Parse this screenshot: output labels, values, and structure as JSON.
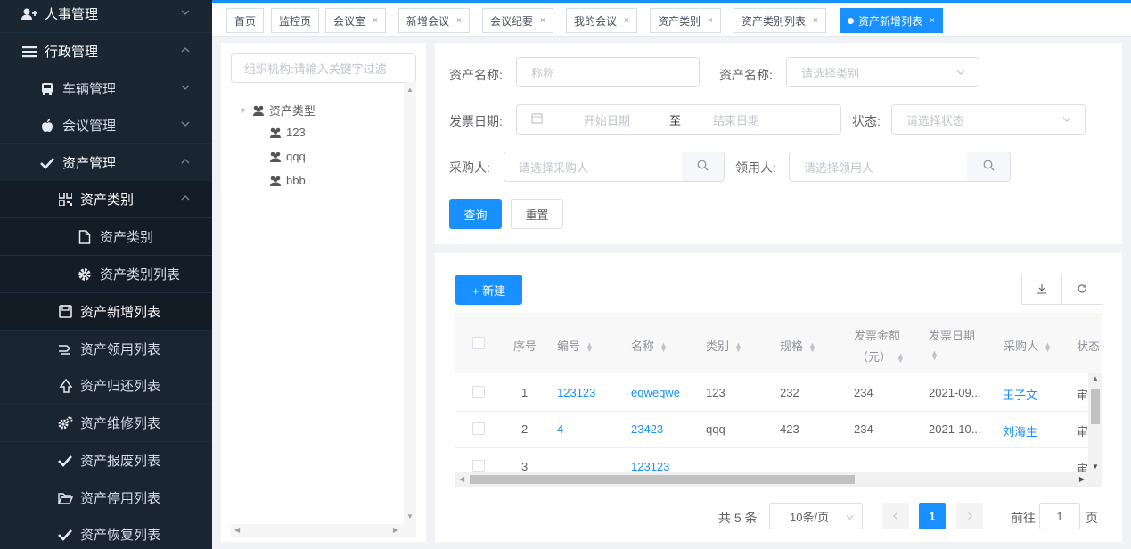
{
  "sidebar": {
    "items": [
      {
        "label": "人事管理",
        "icon": "user-add-icon",
        "chevron": "down"
      },
      {
        "label": "行政管理",
        "icon": "menu-icon",
        "chevron": "up"
      },
      {
        "label": "车辆管理",
        "icon": "bus-icon",
        "chevron": "down"
      },
      {
        "label": "会议管理",
        "icon": "apple-icon",
        "chevron": "down"
      },
      {
        "label": "资产管理",
        "icon": "check-icon",
        "chevron": "up"
      },
      {
        "label": "资产类别",
        "icon": "qrcode-icon",
        "chevron": "up"
      },
      {
        "label": "资产类别",
        "icon": "document-icon"
      },
      {
        "label": "资产类别列表",
        "icon": "gear-icon"
      },
      {
        "label": "资产新增列表",
        "icon": "save-icon"
      },
      {
        "label": "资产领用列表",
        "icon": "receive-icon"
      },
      {
        "label": "资产归还列表",
        "icon": "return-icon"
      },
      {
        "label": "资产维修列表",
        "icon": "gears-icon"
      },
      {
        "label": "资产报废列表",
        "icon": "check-icon"
      },
      {
        "label": "资产停用列表",
        "icon": "folder-open-icon"
      },
      {
        "label": "资产恢复列表",
        "icon": "check-icon"
      }
    ]
  },
  "tabs": [
    {
      "label": "首页",
      "closable": false
    },
    {
      "label": "监控页",
      "closable": false
    },
    {
      "label": "会议室",
      "closable": true
    },
    {
      "label": "新增会议",
      "closable": true
    },
    {
      "label": "会议纪要",
      "closable": true
    },
    {
      "label": "我的会议",
      "closable": true
    },
    {
      "label": "资产类别",
      "closable": true
    },
    {
      "label": "资产类别列表",
      "closable": true
    },
    {
      "label": "资产新增列表",
      "closable": true,
      "active": true
    }
  ],
  "tab_close_glyph": "×",
  "tree": {
    "search_placeholder": "组织机构:请输入关键字过滤",
    "root": "资产类型",
    "children": [
      "123",
      "qqq",
      "bbb"
    ]
  },
  "search": {
    "asset_name_label": "资产名称:",
    "asset_name_placeholder": "称称",
    "category_label": "资产名称:",
    "category_placeholder": "请选择类别",
    "invoice_date_label": "发票日期:",
    "start_placeholder": "开始日期",
    "range_sep": "至",
    "end_placeholder": "结束日期",
    "status_label": "状态:",
    "status_placeholder": "请选择状态",
    "buyer_label": "采购人:",
    "buyer_placeholder": "请选择采购人",
    "receiver_label": "领用人:",
    "receiver_placeholder": "请选择领用人",
    "query_button": "查询",
    "reset_button": "重置"
  },
  "table": {
    "new_button": "+ 新建",
    "columns": [
      "序号",
      "编号",
      "名称",
      "类别",
      "规格",
      "发票金额",
      "（元）",
      "发票日期",
      "采购人",
      "状态"
    ],
    "rows": [
      {
        "index": "1",
        "code": "123123",
        "name": "eqweqwe",
        "category": "123",
        "spec": "232",
        "amount": "234",
        "date": "2021-09...",
        "buyer": "王子文",
        "status": "审"
      },
      {
        "index": "2",
        "code": "4",
        "name": "23423",
        "category": "qqq",
        "spec": "423",
        "amount": "234",
        "date": "2021-10...",
        "buyer": "刘海生",
        "status": "审"
      },
      {
        "index": "3",
        "code": "",
        "name": "123123",
        "category": "",
        "spec": "",
        "amount": "",
        "date": "",
        "buyer": "",
        "status": "审"
      }
    ]
  },
  "pagination": {
    "total": "共 5 条",
    "page_size": "10条/页",
    "current": "1",
    "goto_prefix": "前往",
    "goto_value": "1",
    "goto_suffix": "页"
  },
  "colors": {
    "primary": "#1890ff",
    "sidebar_bg": "#1f2d3d"
  }
}
